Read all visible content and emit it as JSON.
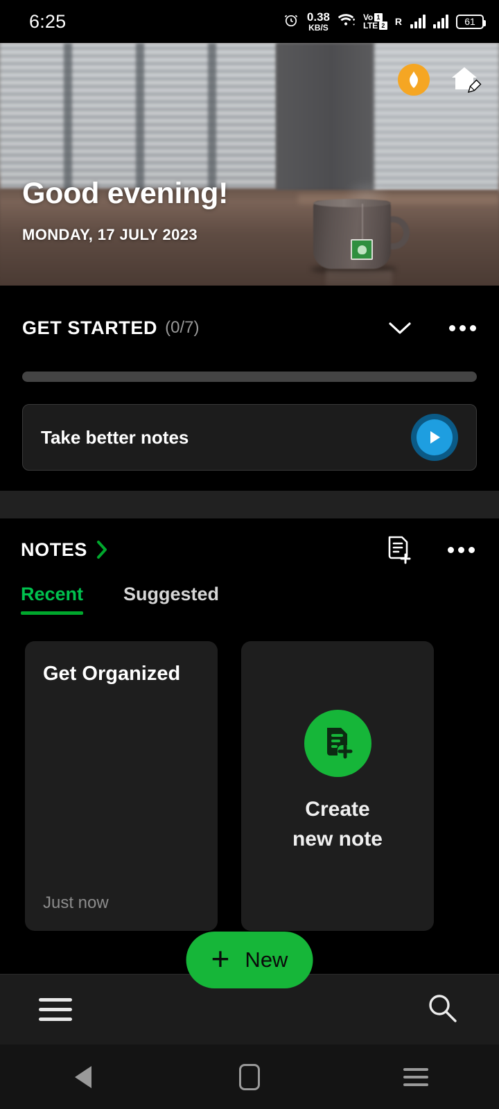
{
  "status_bar": {
    "time": "6:25",
    "alarm_icon": "alarm-clock-icon",
    "network_speed_value": "0.38",
    "network_speed_unit": "KB/S",
    "wifi_icon": "wifi-icon",
    "volte_top": "Vo",
    "volte_bottom": "LTE",
    "sim1_badge": "1",
    "sim2_badge": "2",
    "roaming_label": "R",
    "battery_level": "61"
  },
  "hero": {
    "greeting": "Good evening!",
    "date": "MONDAY, 17 JULY 2023",
    "spark_icon": "spark-diamond-icon",
    "customize_home_icon": "home-pencil-icon",
    "spark_color": "#F5A623"
  },
  "get_started": {
    "title": "GET STARTED",
    "count": "(0/7)",
    "collapse_icon": "chevron-down-icon",
    "more_icon": "more-options-icon",
    "progress_percent": 0,
    "progress_fill_color": "#00a82d",
    "task": {
      "label": "Take better notes",
      "play_icon": "play-icon",
      "play_color": "#1e9ee0"
    }
  },
  "notes": {
    "title": "NOTES",
    "arrow_icon": "chevron-right-icon",
    "new_note_icon": "note-add-icon",
    "more_icon": "more-options-icon",
    "accent_color": "#00a82d",
    "tabs": [
      {
        "label": "Recent",
        "active": true
      },
      {
        "label": "Suggested",
        "active": false
      }
    ],
    "cards": [
      {
        "type": "note",
        "title": "Get Organized",
        "timestamp": "Just now"
      },
      {
        "type": "create",
        "label": "Create\nnew note",
        "line1": "Create",
        "line2": "new note",
        "icon": "note-add-circle-icon",
        "circle_color": "#16b639"
      }
    ]
  },
  "fab": {
    "plus_glyph": "+",
    "label": "New",
    "color": "#16b639"
  },
  "bottom_bar": {
    "menu_icon": "hamburger-menu-icon",
    "search_icon": "search-icon"
  },
  "nav_bar": {
    "back_icon": "back-triangle-icon",
    "home_icon": "home-square-icon",
    "recents_icon": "recent-apps-icon"
  }
}
